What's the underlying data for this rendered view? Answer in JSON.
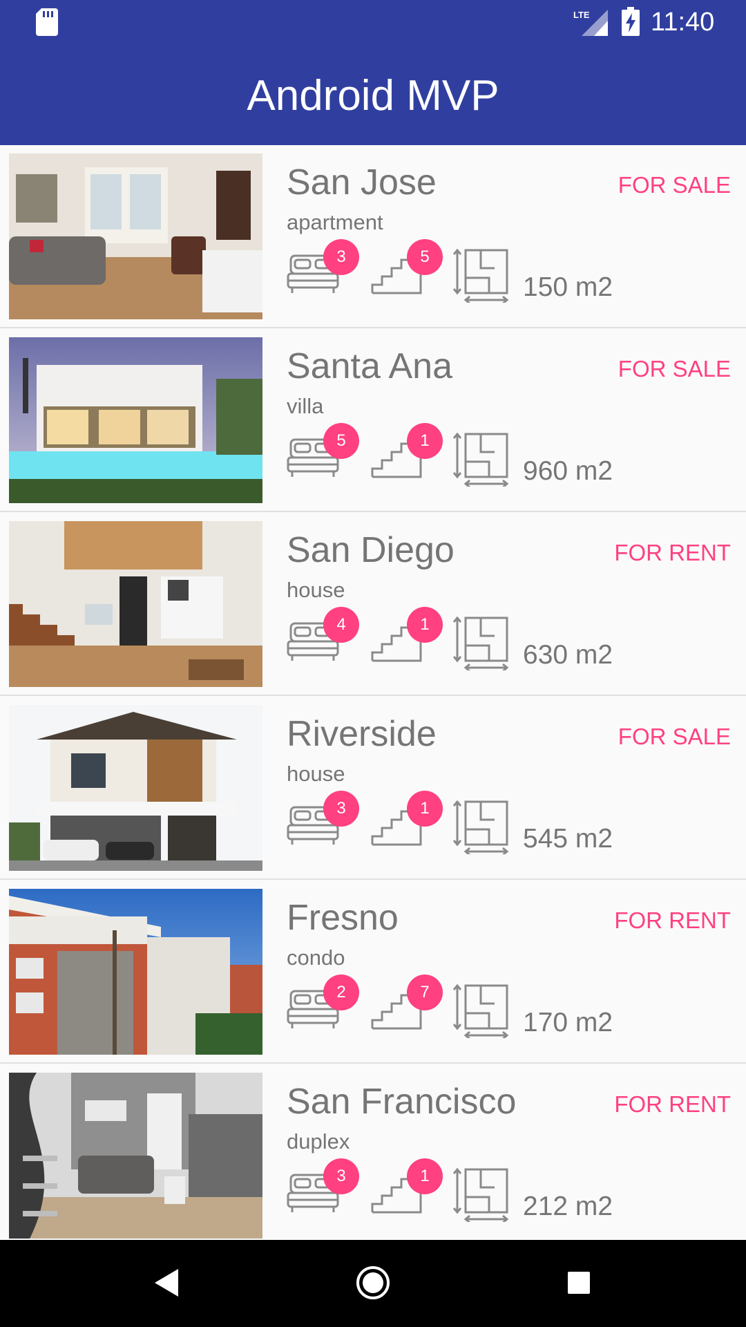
{
  "status_bar": {
    "time": "11:40",
    "network_label": "LTE",
    "icons": [
      "sd-card-icon",
      "lte-signal-icon",
      "battery-charging-icon"
    ]
  },
  "app_bar": {
    "title": "Android MVP"
  },
  "colors": {
    "primary": "#303f9f",
    "accent": "#ff4081",
    "text_secondary": "#757575",
    "icon_gray": "#8a8a8a"
  },
  "listings": [
    {
      "city": "San Jose",
      "type": "apartment",
      "status": "FOR SALE",
      "bedrooms": "3",
      "floors": "5",
      "area": "150 m2",
      "image": "living-room-photo"
    },
    {
      "city": "Santa Ana",
      "type": "villa",
      "status": "FOR SALE",
      "bedrooms": "5",
      "floors": "1",
      "area": "960 m2",
      "image": "villa-pool-photo"
    },
    {
      "city": "San Diego",
      "type": "house",
      "status": "FOR RENT",
      "bedrooms": "4",
      "floors": "1",
      "area": "630 m2",
      "image": "loft-interior-photo"
    },
    {
      "city": "Riverside",
      "type": "house",
      "status": "FOR SALE",
      "bedrooms": "3",
      "floors": "1",
      "area": "545 m2",
      "image": "two-story-house-photo"
    },
    {
      "city": "Fresno",
      "type": "condo",
      "status": "FOR RENT",
      "bedrooms": "2",
      "floors": "7",
      "area": "170 m2",
      "image": "condo-building-photo"
    },
    {
      "city": "San Francisco",
      "type": "duplex",
      "status": "FOR RENT",
      "bedrooms": "3",
      "floors": "1",
      "area": "212 m2",
      "image": "duplex-interior-photo"
    }
  ],
  "nav_bar": {
    "icons": [
      "back-icon",
      "home-icon",
      "recents-icon"
    ]
  }
}
